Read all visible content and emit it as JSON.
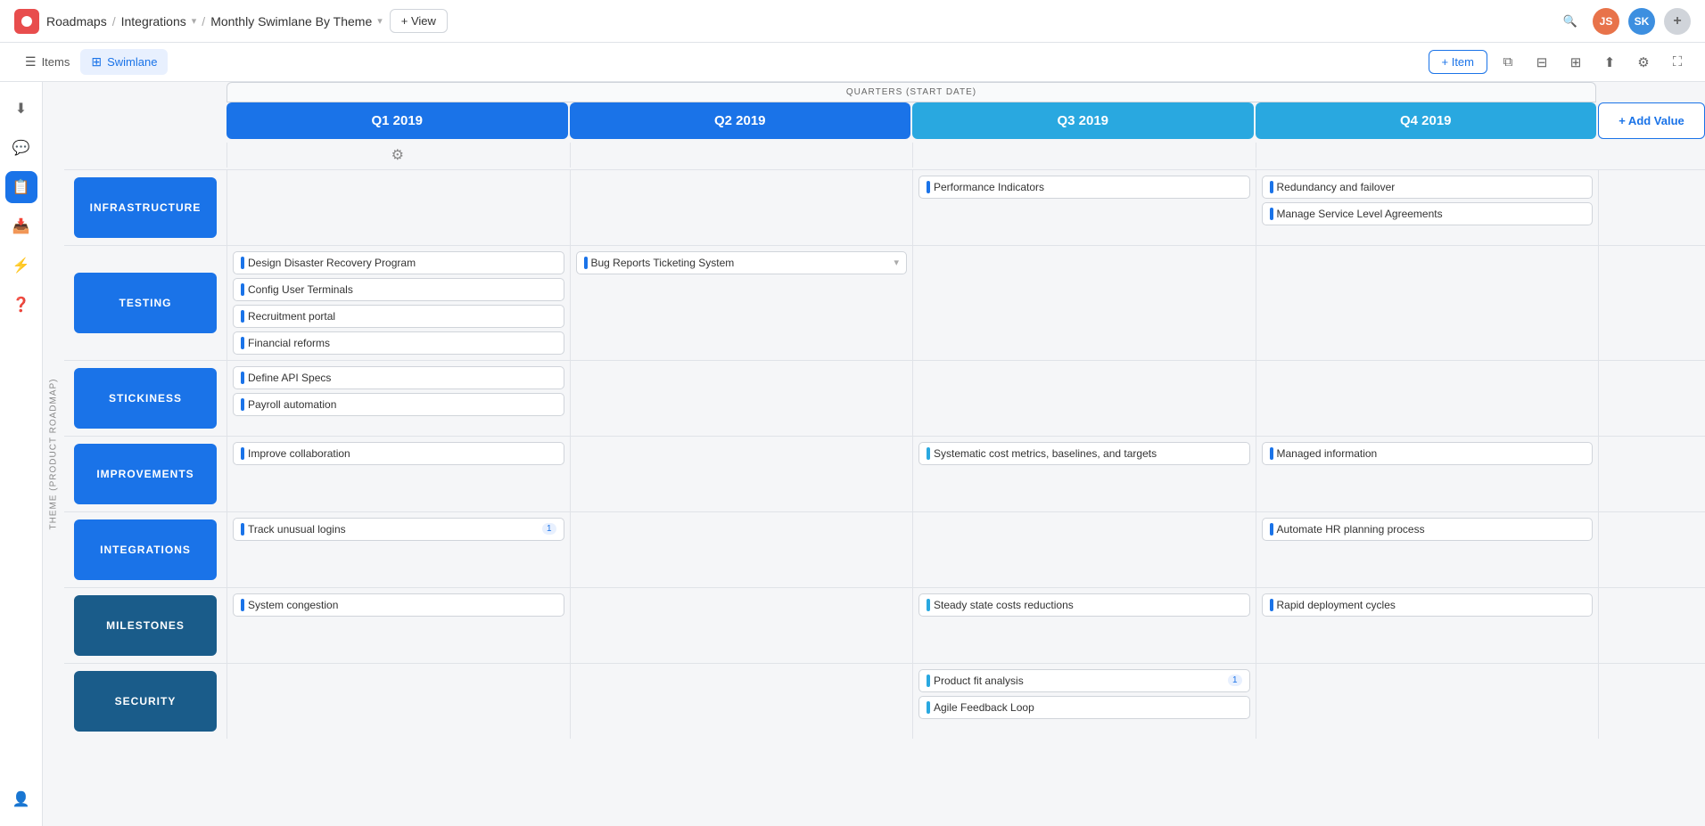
{
  "app": {
    "logo_aria": "ProductBoard Logo"
  },
  "nav": {
    "breadcrumb": [
      {
        "label": "Roadmaps",
        "active": false
      },
      {
        "label": "Integrations",
        "active": false,
        "has_chevron": true
      },
      {
        "label": "Monthly Swimlane By Theme",
        "active": true,
        "has_chevron": true
      }
    ],
    "view_btn": "+ View",
    "avatars": [
      {
        "initials": "JS",
        "class": "av-js"
      },
      {
        "initials": "SK",
        "class": "av-sk"
      },
      {
        "initials": "+",
        "class": "av-plus"
      }
    ]
  },
  "tabs": {
    "items_label": "Items",
    "swimlane_label": "Swimlane",
    "add_item_label": "+ Item"
  },
  "grid": {
    "quarters_label": "QUARTERS (START DATE)",
    "add_value_label": "+ Add Value",
    "columns": [
      {
        "label": "Q1 2019",
        "class": "q1"
      },
      {
        "label": "Q2 2019",
        "class": "q2"
      },
      {
        "label": "Q3 2019",
        "class": "q3"
      },
      {
        "label": "Q4 2019",
        "class": "q4"
      }
    ],
    "rotated_label": "THEME (PRODUCT ROADMAP)",
    "rows": [
      {
        "label": "INFRASTRUCTURE",
        "class": "infrastructure",
        "cells": [
          [],
          [],
          [
            {
              "text": "Performance Indicators",
              "bar": "blue"
            }
          ],
          [
            {
              "text": "Redundancy and failover",
              "bar": "blue"
            },
            {
              "text": "Manage Service Level Agreements",
              "bar": "blue"
            }
          ]
        ]
      },
      {
        "label": "TESTING",
        "class": "testing",
        "cells": [
          [
            {
              "text": "Design Disaster Recovery Program",
              "bar": "blue"
            },
            {
              "text": "Config User Terminals",
              "bar": "blue"
            },
            {
              "text": "Recruitment portal",
              "bar": "blue"
            },
            {
              "text": "Financial reforms",
              "bar": "blue"
            }
          ],
          [
            {
              "text": "Bug Reports Ticketing System",
              "bar": "blue",
              "chevron": true
            }
          ],
          [],
          []
        ]
      },
      {
        "label": "STICKINESS",
        "class": "stickiness",
        "cells": [
          [
            {
              "text": "Define API Specs",
              "bar": "blue"
            },
            {
              "text": "Payroll automation",
              "bar": "blue"
            }
          ],
          [],
          [],
          []
        ]
      },
      {
        "label": "IMPROVEMENTS",
        "class": "improvements",
        "cells": [
          [
            {
              "text": "Improve collaboration",
              "bar": "blue"
            }
          ],
          [],
          [
            {
              "text": "Systematic cost metrics, baselines, and targets",
              "bar": "teal"
            }
          ],
          [
            {
              "text": "Managed information",
              "bar": "blue"
            }
          ]
        ]
      },
      {
        "label": "INTEGRATIONS",
        "class": "integrations",
        "cells": [
          [
            {
              "text": "Track unusual logins",
              "bar": "blue",
              "badge": "1"
            }
          ],
          [],
          [],
          [
            {
              "text": "Automate HR planning process",
              "bar": "blue"
            }
          ]
        ]
      },
      {
        "label": "MILESTONES",
        "class": "milestones",
        "cells": [
          [
            {
              "text": "System congestion",
              "bar": "blue"
            }
          ],
          [],
          [
            {
              "text": "Steady state costs reductions",
              "bar": "teal"
            }
          ],
          [
            {
              "text": "Rapid deployment cycles",
              "bar": "blue"
            }
          ]
        ]
      },
      {
        "label": "SECURITY",
        "class": "security",
        "cells": [
          [],
          [],
          [
            {
              "text": "Product fit analysis",
              "bar": "teal",
              "badge": "1"
            },
            {
              "text": "Agile Feedback Loop",
              "bar": "teal"
            }
          ],
          []
        ]
      }
    ]
  },
  "sidebar_icons": [
    "☰",
    "⬇",
    "💬",
    "📋",
    "⚡",
    "❓",
    "👤"
  ]
}
